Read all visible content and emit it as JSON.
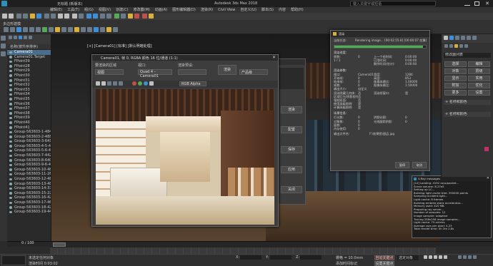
{
  "title_bar": {
    "title": "无标题 (新版本)",
    "app": "Autodesk 3ds Max 2018",
    "search_placeholder": "键入关键字或短语"
  },
  "menu": [
    "编辑(E)",
    "工具(T)",
    "组(G)",
    "视图(V)",
    "创建(C)",
    "修改器(M)",
    "动画(A)",
    "图形编辑器(D)",
    "渲染(R)",
    "Civil View",
    "自定义(U)",
    "脚本(S)",
    "内容",
    "帮助(H)"
  ],
  "workspace_label": "多边形建模",
  "scene_explorer": {
    "header": "名称(按升序排序)",
    "items": [
      "Camera01",
      "Camera01.Target",
      "FPoint39",
      "FPoint28",
      "FPoint29",
      "FPoint30",
      "FPoint31",
      "FPoint32",
      "FPoint33",
      "FPoint34",
      "FPoint35",
      "FPoint36",
      "FPoint37",
      "FPoint38",
      "FPoint39",
      "FPoint40",
      "FPoint41",
      "Group-563603-1-484",
      "Group-563603-2-488",
      "Group-563603-3-6413",
      "Group-563603-4-5-400",
      "Group-563603-5-6-413",
      "Group-563603-7-442",
      "Group-563603-8-6403",
      "Group-563603-9-6-480",
      "Group-563603-10-480",
      "Group-563603-11-26",
      "Group-563603-12-488",
      "Group-563603-13-488",
      "Group-563603-14-379",
      "Group-563603-15-222",
      "Group-563603-16-423",
      "Group-563603-17-463",
      "Group-563603-18-425",
      "Group-563603-19-440"
    ],
    "selected_index": 0
  },
  "viewport_label": "[+] [Camera01] [标准] [默认明暗处理]",
  "frame_buffer": {
    "title": "Camera01, 帧 0, RGBA 颜色 16 位/通道 (1:1)",
    "area_label": "要渲染的区域",
    "area_value": "视图",
    "viewport_label": "视口:",
    "viewport_value": "Quad 4 - Camera01",
    "preset_label": "渲染预设:",
    "render_button": "渲染",
    "output_value": "产品级",
    "channel_value": "RGB Alpha"
  },
  "render_dialog": {
    "title": "渲染",
    "current_task_label": "当前任务:",
    "current_task_value": "Rendering image... [00:02:55.8] [00:00:07 估算值]",
    "progress": 0.97,
    "render_params_header": "渲染进度:",
    "rows": [
      [
        "帧数:",
        "0",
        "上一个帧时间:",
        "0:00:00"
      ],
      [
        "1 / 1",
        "",
        "已用时间:",
        "0:00:00"
      ],
      [
        "",
        "",
        "剩余时间(估计):",
        "0:00:00"
      ]
    ],
    "output_header": "渲染参数:",
    "params": [
      [
        "视口:",
        "Camera01",
        "宽度:",
        "1280"
      ],
      [
        "开始帧:",
        "0",
        "高度:",
        "853"
      ],
      [
        "结束帧:",
        "0",
        "像素纵横比:",
        "1.00000"
      ],
      [
        "帧数:",
        "0",
        "图像纵横比:",
        "1.50000"
      ],
      [
        "输出大小:",
        "自定义",
        "",
        ""
      ],
      [
        "渲染隐藏几何体:",
        "否",
        "渲染帧窗口:",
        "是"
      ],
      [
        "区域灯光/阴影视作点光源:",
        "否",
        "",
        ""
      ],
      [
        "强制双面:",
        "否",
        "",
        ""
      ],
      [
        "使用高级照明:",
        "是",
        "",
        ""
      ],
      [
        "计算高级照明:",
        "是",
        "",
        ""
      ]
    ],
    "scene_header": "场景信息:",
    "scene_rows": [
      [
        "灯光数:",
        "0",
        "阴影贴图:",
        "0"
      ],
      [
        "对象数:",
        "0",
        "光线跟踪阴影:",
        "0"
      ],
      [
        "面数:",
        "0",
        "",
        ""
      ],
      [
        "内存使用:",
        "0",
        "",
        ""
      ]
    ],
    "output_file_label": "输出文件名:",
    "output_file_value": "F:\\效果图\\甜品.jpg",
    "pause_button": "暂停",
    "cancel_button": "取消"
  },
  "vray_log": {
    "title": "V-Ray messages",
    "lines": [
      "[10] Loading: 4192 rays/packet...",
      "Scene volume: 8.27e5",
      "Setting up LC...",
      "Building light cache tree: 350000 points",
      "Sampling incident light...",
      "Light cache: 8 frames",
      "Building embree static accelerator...",
      "Memory used: 420 MB",
      "Preparing ray server...",
      "Number of samples: 12",
      "Image sampler: adaptive",
      "Tracing 256x256 image samples...",
      "Light cache: 75 entries",
      "Average rays per pixel: 4.23",
      "Total render time: 0h 3m 2.8s"
    ]
  },
  "side_panel": {
    "title": "修改器列表",
    "buttons": [
      "选择",
      "编辑",
      "对象",
      "层级",
      "显示",
      "实用",
      "附加",
      "优化",
      "更多",
      "设置"
    ],
    "section1": "+ 名称和颜色",
    "section2": "+ 名称和颜色"
  },
  "float_panel": {
    "buttons": [
      "渲染",
      "配置",
      "保存",
      "应用",
      "关闭"
    ]
  },
  "status": {
    "left_line1": "未选定任何对象",
    "left_line2": "渲染时间 0:03:02",
    "x_label": "X:",
    "y_label": "Y:",
    "z_label": "Z:",
    "grid": "栅格 = 10.0mm",
    "add_key": "添加时间标记",
    "frame_counter": "0 / 100",
    "auto_key": "自动关键点",
    "set_key": "设置关键点",
    "selection": "选定对象"
  },
  "colors": {
    "accent": "#3d8fd6",
    "progress": "#4caf50",
    "selection": "#4a6d8c",
    "bg": "#2b2b2b"
  }
}
